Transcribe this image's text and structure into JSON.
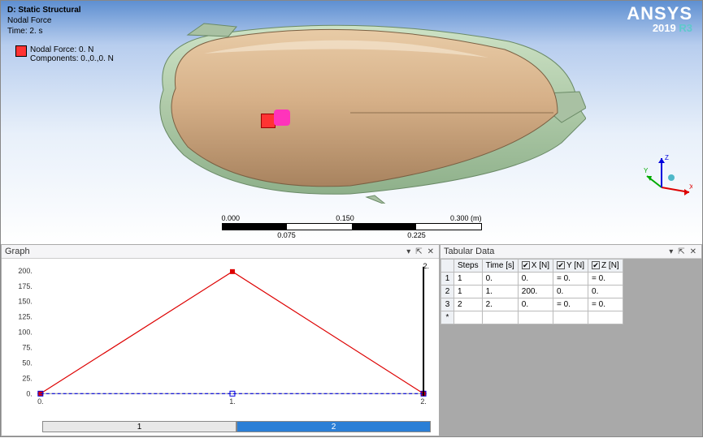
{
  "viewport": {
    "title": "D: Static Structural",
    "sub1": "Nodal Force",
    "sub2": "Time: 2. s",
    "legend_label": "Nodal Force: 0. N",
    "legend_sub": "Components: 0.,0.,0. N"
  },
  "brand": {
    "name": "ANSYS",
    "ver_a": "2019 ",
    "ver_b": "R3"
  },
  "triad": {
    "x": "X",
    "y": "Y",
    "z": "Z"
  },
  "scale": {
    "t0": "0.000",
    "t1": "0.150",
    "t2": "0.300 (m)",
    "u0": "0.075",
    "u1": "0.225"
  },
  "chart_data": {
    "type": "line",
    "title": "",
    "xlabel": "",
    "ylabel": "",
    "x": [
      0,
      1,
      2
    ],
    "series": [
      {
        "name": "X [N]",
        "values": [
          0,
          200,
          0
        ],
        "color": "#d00"
      },
      {
        "name": "Y [N]",
        "values": [
          0,
          0,
          0
        ],
        "color": "#00d"
      },
      {
        "name": "Z [N]",
        "values": [
          0,
          0,
          0
        ],
        "color": "#00d"
      }
    ],
    "ylim": [
      0,
      200
    ],
    "xlim": [
      0,
      2
    ],
    "xticks": [
      "0.",
      "1.",
      "2."
    ],
    "yticks": [
      "0.",
      "25.",
      "50.",
      "75.",
      "100.",
      "125.",
      "150.",
      "175.",
      "200."
    ],
    "step_labels": [
      "1",
      "2"
    ],
    "top_right_label": "2."
  },
  "panels": {
    "graph_title": "Graph",
    "tabular_title": "Tabular Data",
    "pin": "▾",
    "pin2": "⇱",
    "close": "✕"
  },
  "table": {
    "headers": [
      "",
      "Steps",
      "Time [s]",
      "X [N]",
      "Y [N]",
      "Z [N]"
    ],
    "check": "✔",
    "rows": [
      {
        "n": "1",
        "steps": "1",
        "time": "0.",
        "x": "0.",
        "y": "= 0.",
        "z": "= 0."
      },
      {
        "n": "2",
        "steps": "1",
        "time": "1.",
        "x": "200.",
        "y": "0.",
        "z": "0."
      },
      {
        "n": "3",
        "steps": "2",
        "time": "2.",
        "x": "0.",
        "y": "= 0.",
        "z": "= 0."
      }
    ],
    "blank": "*"
  }
}
